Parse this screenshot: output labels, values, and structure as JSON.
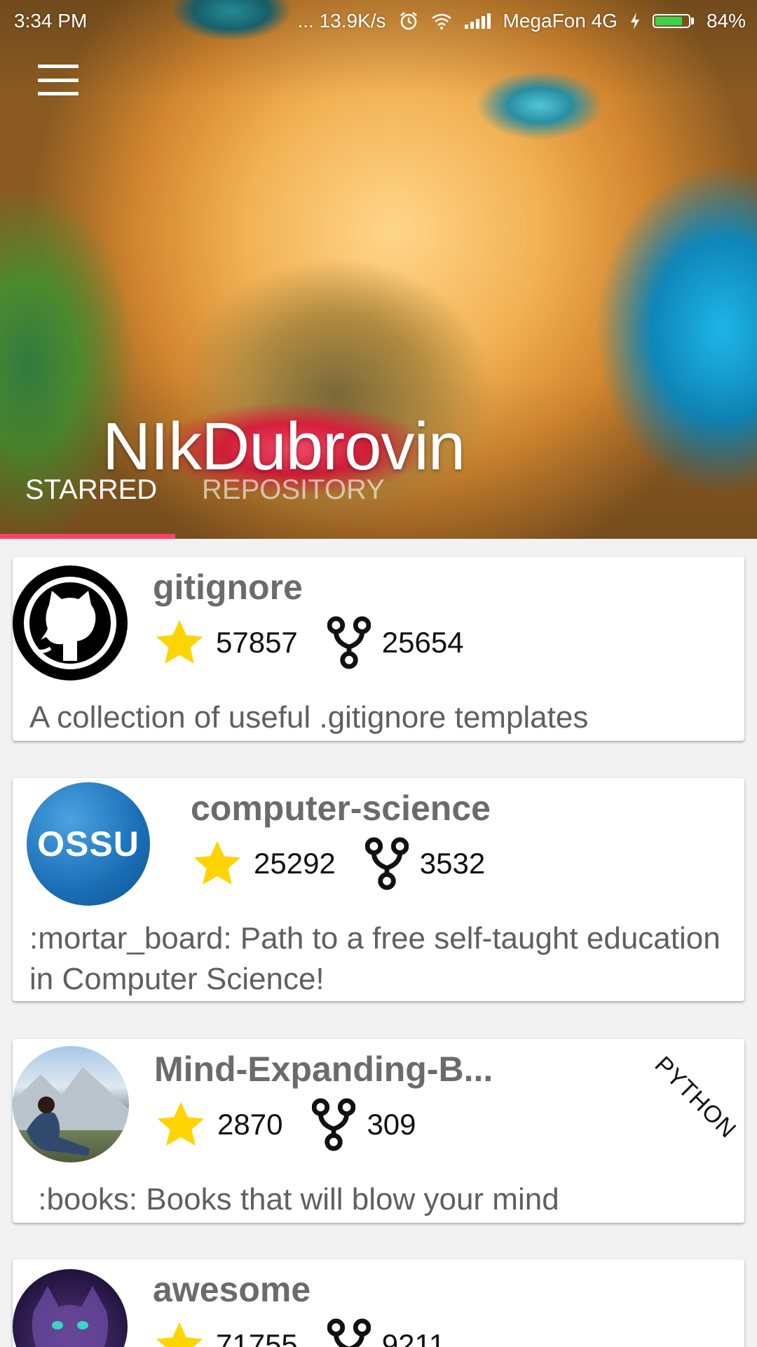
{
  "status_bar": {
    "time": "3:34 PM",
    "network_speed": "... 13.9K/s",
    "carrier": "MegaFon 4G",
    "battery": "84%",
    "battery_level": 0.84
  },
  "header": {
    "profile_name": "NIkDubrovin",
    "tabs": [
      {
        "label": "STARRED",
        "active": true
      },
      {
        "label": "REPOSITORY",
        "active": false
      }
    ]
  },
  "repos": [
    {
      "name": "gitignore",
      "stars": "57857",
      "forks": "25654",
      "description": "A collection of useful .gitignore templates",
      "avatar": "github-octocat-icon"
    },
    {
      "name": "computer-science",
      "stars": "25292",
      "forks": "3532",
      "description": ":mortar_board: Path to a free self-taught education in Computer Science!",
      "avatar_text": "OSSU"
    },
    {
      "name": "Mind-Expanding-B...",
      "stars": "2870",
      "forks": "309",
      "description": " :books: Books that will blow your mind",
      "language": "PYTHON",
      "avatar": "person-landscape-photo"
    },
    {
      "name": "awesome",
      "stars": "71755",
      "forks": "9211",
      "avatar": "cat-photo"
    }
  ],
  "colors": {
    "tab_indicator": "#ff3f6e",
    "star": "#ffd400",
    "repo_name": "#6b6b6b"
  }
}
